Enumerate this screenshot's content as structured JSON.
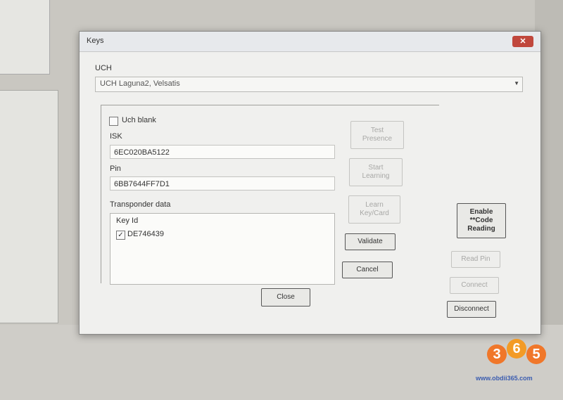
{
  "window": {
    "title": "Keys"
  },
  "uch": {
    "label": "UCH",
    "selected": "UCH Laguna2, Velsatis"
  },
  "uch_blank": {
    "label": "Uch blank",
    "checked": false
  },
  "isk": {
    "label": "ISK",
    "value": "6EC020BA5122"
  },
  "pin": {
    "label": "Pin",
    "value": "6BB7644FF7D1"
  },
  "transponder": {
    "label": "Transponder data",
    "column_header": "Key Id",
    "items": [
      {
        "key_id": "DE746439",
        "checked": true
      }
    ]
  },
  "buttons": {
    "test_presence": "Test\nPresence",
    "start_learning": "Start\nLearning",
    "learn_keycard": "Learn\nKey/Card",
    "validate": "Validate",
    "cancel": "Cancel",
    "close": "Close",
    "enable_code_reading": "Enable\n**Code\nReading",
    "read_pin": "Read Pin",
    "connect": "Connect",
    "disconnect": "Disconnect"
  },
  "watermark": {
    "logo_digits": [
      "3",
      "6",
      "5"
    ],
    "site": "www.obdii365.com"
  }
}
